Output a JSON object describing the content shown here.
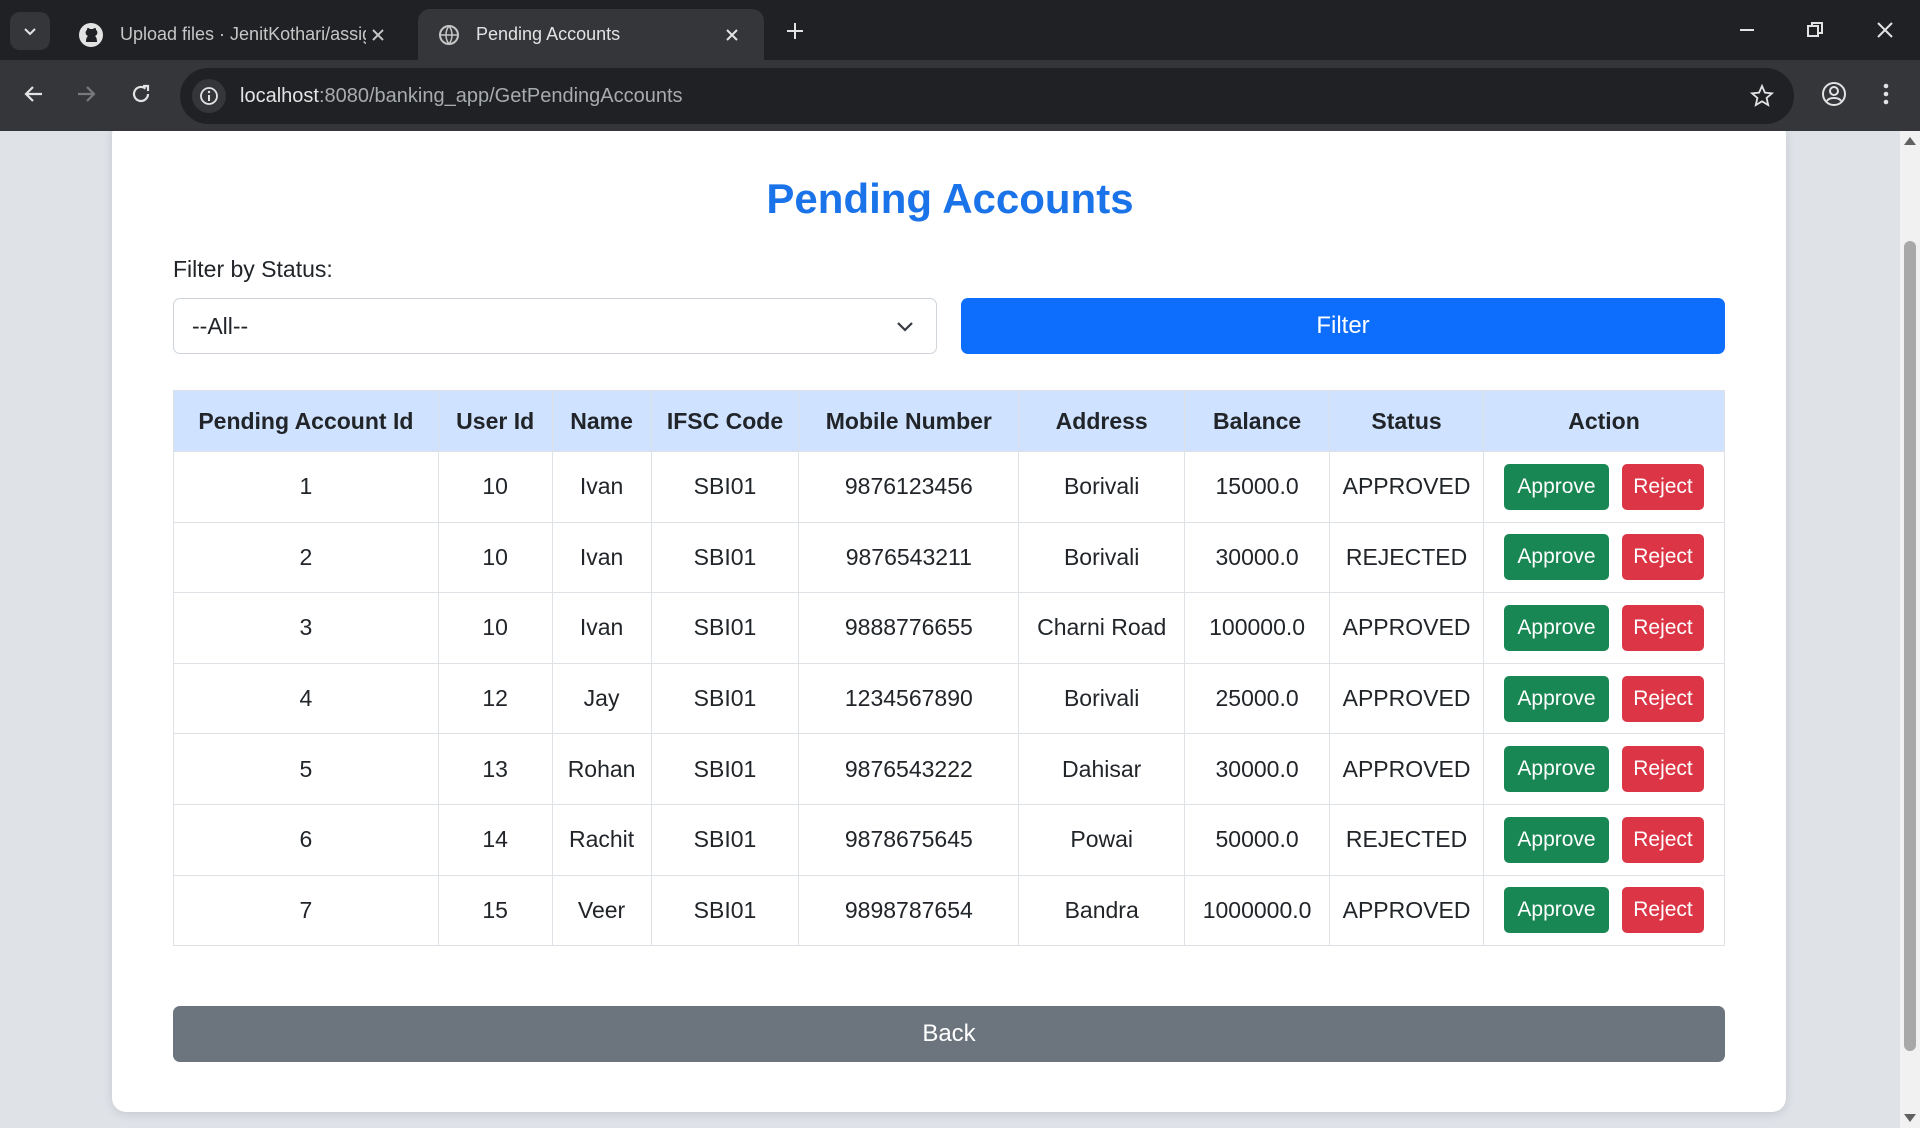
{
  "browser": {
    "tabs": [
      {
        "title": "Upload files · JenitKothari/assig",
        "active": false,
        "icon": "github-icon"
      },
      {
        "title": "Pending Accounts",
        "active": true,
        "icon": "globe-icon"
      }
    ],
    "url_host": "localhost",
    "url_rest": ":8080/banking_app/GetPendingAccounts"
  },
  "page": {
    "title": "Pending Accounts",
    "filter_label": "Filter by Status:",
    "filter_select_value": "--All--",
    "filter_button": "Filter",
    "back_button": "Back"
  },
  "table": {
    "headers": [
      "Pending Account Id",
      "User Id",
      "Name",
      "IFSC Code",
      "Mobile Number",
      "Address",
      "Balance",
      "Status",
      "Action"
    ],
    "rows": [
      {
        "id": "1",
        "user_id": "10",
        "name": "Ivan",
        "ifsc": "SBI01",
        "mobile": "9876123456",
        "address": "Borivali",
        "balance": "15000.0",
        "status": "APPROVED"
      },
      {
        "id": "2",
        "user_id": "10",
        "name": "Ivan",
        "ifsc": "SBI01",
        "mobile": "9876543211",
        "address": "Borivali",
        "balance": "30000.0",
        "status": "REJECTED"
      },
      {
        "id": "3",
        "user_id": "10",
        "name": "Ivan",
        "ifsc": "SBI01",
        "mobile": "9888776655",
        "address": "Charni Road",
        "balance": "100000.0",
        "status": "APPROVED"
      },
      {
        "id": "4",
        "user_id": "12",
        "name": "Jay",
        "ifsc": "SBI01",
        "mobile": "1234567890",
        "address": "Borivali",
        "balance": "25000.0",
        "status": "APPROVED"
      },
      {
        "id": "5",
        "user_id": "13",
        "name": "Rohan",
        "ifsc": "SBI01",
        "mobile": "9876543222",
        "address": "Dahisar",
        "balance": "30000.0",
        "status": "APPROVED"
      },
      {
        "id": "6",
        "user_id": "14",
        "name": "Rachit",
        "ifsc": "SBI01",
        "mobile": "9878675645",
        "address": "Powai",
        "balance": "50000.0",
        "status": "REJECTED"
      },
      {
        "id": "7",
        "user_id": "15",
        "name": "Veer",
        "ifsc": "SBI01",
        "mobile": "9898787654",
        "address": "Bandra",
        "balance": "1000000.0",
        "status": "APPROVED"
      }
    ],
    "approve_label": "Approve",
    "reject_label": "Reject"
  },
  "colors": {
    "title": "#1a73e8",
    "filter_button": "#0d6efd",
    "table_header": "#cfe2ff",
    "approve": "#198754",
    "reject": "#dc3545",
    "back": "#6c757d"
  }
}
